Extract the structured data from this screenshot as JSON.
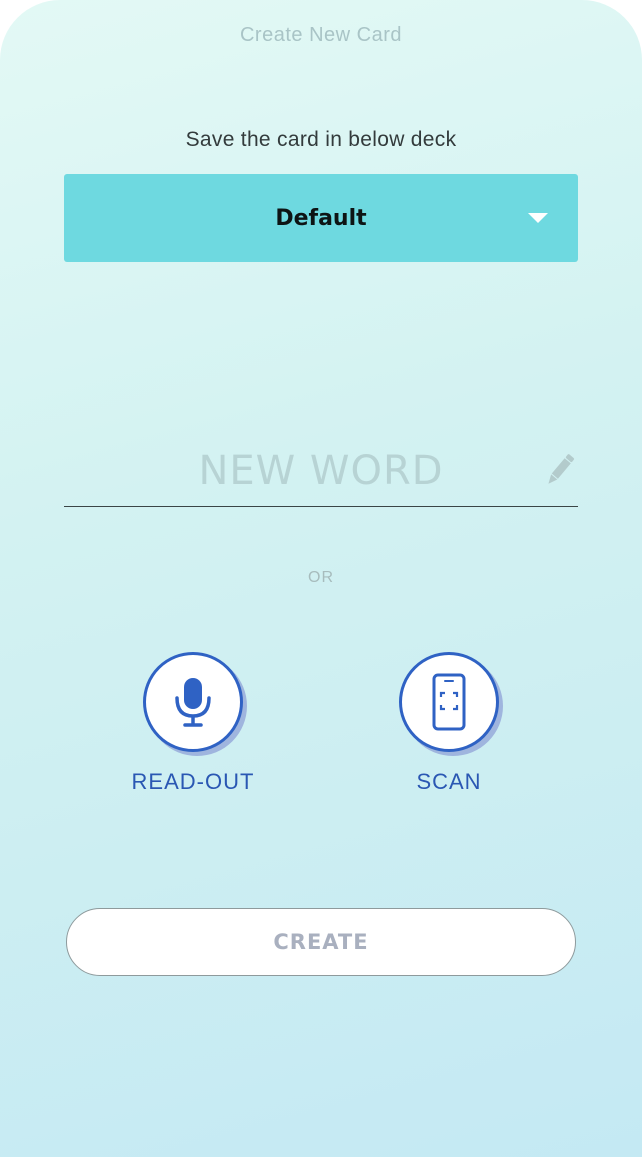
{
  "header": {
    "title": "Create New Card"
  },
  "deck": {
    "label": "Save the card in below deck",
    "selected": "Default"
  },
  "word": {
    "placeholder": "NEW WORD",
    "value": ""
  },
  "separator": {
    "text": "OR"
  },
  "actions": {
    "read_out": {
      "label": "READ-OUT",
      "icon": "microphone-icon"
    },
    "scan": {
      "label": "SCAN",
      "icon": "phone-scan-icon"
    }
  },
  "create": {
    "label": "CREATE"
  },
  "colors": {
    "select_background": "#6ed9e0",
    "accent_blue": "#2f62c4",
    "background_start": "#e3f9f5",
    "background_end": "#c4e9f3"
  }
}
